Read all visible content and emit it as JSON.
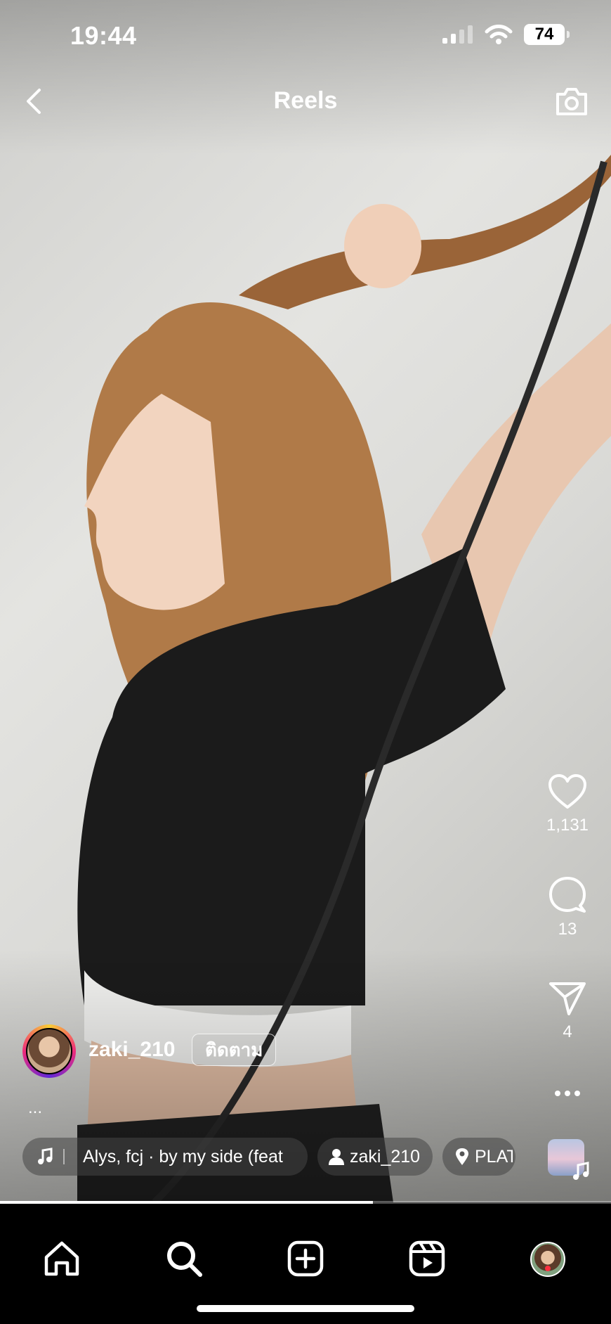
{
  "status_bar": {
    "time": "19:44",
    "battery": "74"
  },
  "header": {
    "title": "Reels"
  },
  "actions": {
    "likes": "1,131",
    "comments": "13",
    "shares": "4"
  },
  "author": {
    "username": "zaki_210",
    "follow_label": "ติดตาม"
  },
  "caption": {
    "more": "..."
  },
  "chips": {
    "music": "Alys, fcj · by my side (feat",
    "tagged_user": "zaki_210",
    "location": "PLAT"
  },
  "video_progress": 0.61,
  "colors": {
    "accent_dot": "#ff3040",
    "background": "#000000"
  },
  "icons": [
    "back-icon",
    "camera-icon",
    "heart-icon",
    "comment-icon",
    "send-icon",
    "more-icon",
    "music-note-icon",
    "person-icon",
    "location-pin-icon",
    "home-icon",
    "search-icon",
    "create-icon",
    "reels-icon"
  ]
}
